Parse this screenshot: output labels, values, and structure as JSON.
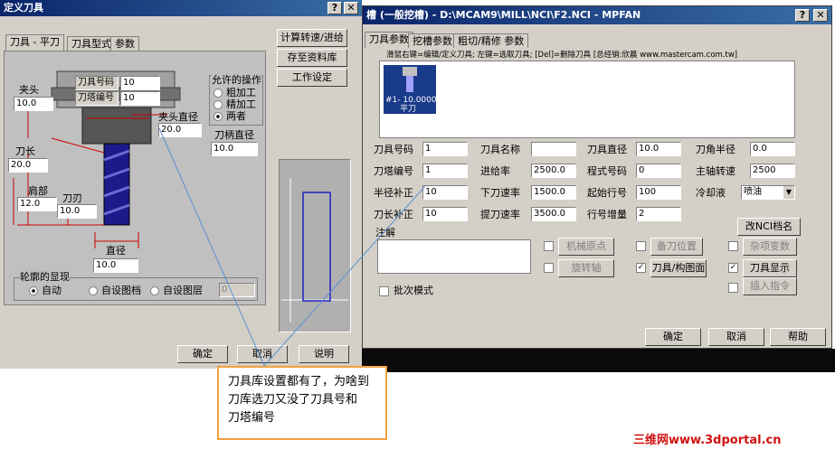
{
  "left": {
    "title": "定义刀具",
    "tabs": [
      "刀具 - 平刀",
      "刀具型式",
      "参数"
    ],
    "cutter_label": "刀具号码",
    "cutter_value": "10",
    "turret_label": "刀塔编号",
    "turret_value": "10",
    "chuck_label": "夹头",
    "chuck_value": "10.0",
    "chuck_dia_label": "夹头直径",
    "chuck_dia_value": "20.0",
    "shank_label": "刀柄直径",
    "shank_value": "10.0",
    "length_label": "刀长",
    "length_value": "20.0",
    "shoulder_label": "肩部",
    "shoulder_value": "12.0",
    "flute_label": "刀刃",
    "flute_value": "10.0",
    "dia_label": "直径",
    "dia_value": "10.0",
    "allowed_label": "允许的操作",
    "ops": [
      "粗加工",
      "精加工",
      "两者"
    ],
    "contour_label": "轮廓的显现",
    "contour_opts": [
      "自动",
      "自设图档",
      "自设图层"
    ],
    "contour_value": "0",
    "side_buttons": [
      "计算转速/进给",
      "存至资料库",
      "工作设定"
    ],
    "bottom_buttons": [
      "确定",
      "取消",
      "说明"
    ]
  },
  "right": {
    "title": "槽 (一般挖槽) - D:\\MCAM9\\MILL\\NCI\\F2.NCI - MPFAN",
    "tabs": [
      "刀具参数",
      "挖槽参数",
      "粗切/精修 参数"
    ],
    "hint": "滑鼠右键=编辑/定义刀具; 左键=选取刀具; [Del]=删除刀具 [总经销:欣晨 www.mastercam.com.tw]",
    "tool_item": [
      "#1- 10.0000",
      "平刀"
    ],
    "fields": [
      {
        "label": "刀具号码",
        "value": "1"
      },
      {
        "label": "刀具名称",
        "value": ""
      },
      {
        "label": "刀具直径",
        "value": "10.0"
      },
      {
        "label": "刀角半径",
        "value": "0.0"
      },
      {
        "label": "刀塔编号",
        "value": "1"
      },
      {
        "label": "进给率",
        "value": "2500.0"
      },
      {
        "label": "程式号码",
        "value": "0"
      },
      {
        "label": "主轴转速",
        "value": "2500"
      },
      {
        "label": "半径补正",
        "value": "10"
      },
      {
        "label": "下刀速率",
        "value": "1500.0"
      },
      {
        "label": "起始行号",
        "value": "100"
      },
      {
        "label": "半径补正_c",
        "value": ""
      },
      {
        "label": "刀长补正",
        "value": "10"
      },
      {
        "label": "提刀速率",
        "value": "3500.0"
      },
      {
        "label": "行号增量",
        "value": "2"
      }
    ],
    "coolant_label": "冷却液",
    "coolant_value": "喷油",
    "rename_btn": "改NCI档名",
    "note_label": "注解",
    "check_items": [
      "机械原点",
      "备刀位置",
      "杂项变数",
      "旋转轴",
      "刀具/构图面",
      "刀具显示",
      "插入指令"
    ],
    "batch_label": "批次模式",
    "bottom_buttons": [
      "确定",
      "取消",
      "帮助"
    ]
  },
  "callout": {
    "line1": "刀具库设置都有了，为啥到",
    "line2": "刀库选刀又没了刀具号和",
    "line3": "刀塔编号"
  },
  "watermark": "三维网www.3dportal.cn"
}
